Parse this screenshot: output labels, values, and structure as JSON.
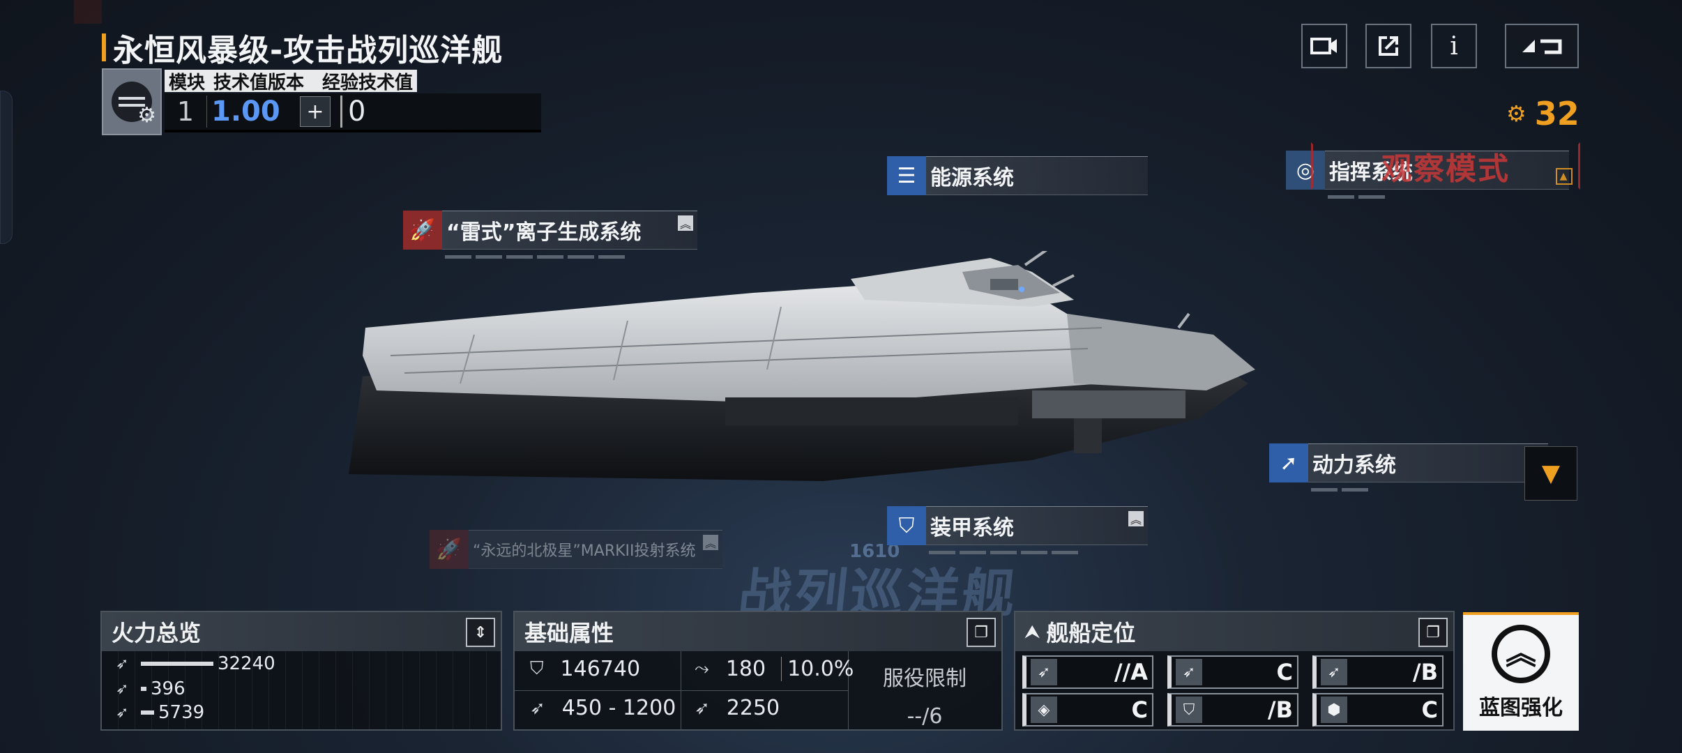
{
  "header": {
    "title": "永恒风暴级-攻击战列巡洋舰",
    "tech_headers": [
      "模块",
      "技术值版本",
      "经验技术值"
    ],
    "module_count": "1",
    "tech_version": "1.00",
    "exp_tech_value": "0",
    "add_symbol": "+"
  },
  "top_right": {
    "camera_icon": "video-camera-icon",
    "share_icon": "share-icon",
    "info_label": "i",
    "back_icon": "back-icon",
    "currency_value": "32"
  },
  "systems": {
    "energy": "能源系统",
    "thunder": "“雷式”离子生成系统",
    "command": "指挥系统",
    "power": "动力系统",
    "armor": "装甲系统",
    "polar": "“永远的北极星”MARKII投射系统"
  },
  "observe_mode": "观察模式",
  "background_text": {
    "class_name": "战列巡洋舰",
    "number": "1610"
  },
  "firepower": {
    "title": "火力总览",
    "rows": [
      {
        "icon": "anti-ship-icon",
        "value": "32240",
        "fraction": 1.0
      },
      {
        "icon": "anti-air-icon",
        "value": "396",
        "fraction": 0.012
      },
      {
        "icon": "siege-icon",
        "value": "5739",
        "fraction": 0.178
      }
    ]
  },
  "basic": {
    "title": "基础属性",
    "hp": "146740",
    "evasion": "180",
    "evasion_rate": "10.0%",
    "speed": "450 - 1200",
    "warp": "2250",
    "service_label": "服役限制",
    "service_value": "--/6"
  },
  "position": {
    "title": "舰船定位",
    "cells": [
      {
        "icon": "anti-ship-icon",
        "grade": "//A"
      },
      {
        "icon": "anti-air-icon",
        "grade": "C"
      },
      {
        "icon": "siege-icon",
        "grade": "/B"
      },
      {
        "icon": "support-icon",
        "grade": "C"
      },
      {
        "icon": "defense-icon",
        "grade": "/B"
      },
      {
        "icon": "utility-icon",
        "grade": "C"
      }
    ]
  },
  "enhance": {
    "label": "蓝图强化"
  },
  "colors": {
    "accent": "#f0a020",
    "tech_version": "#5b97f5",
    "observe": "#c83838"
  }
}
